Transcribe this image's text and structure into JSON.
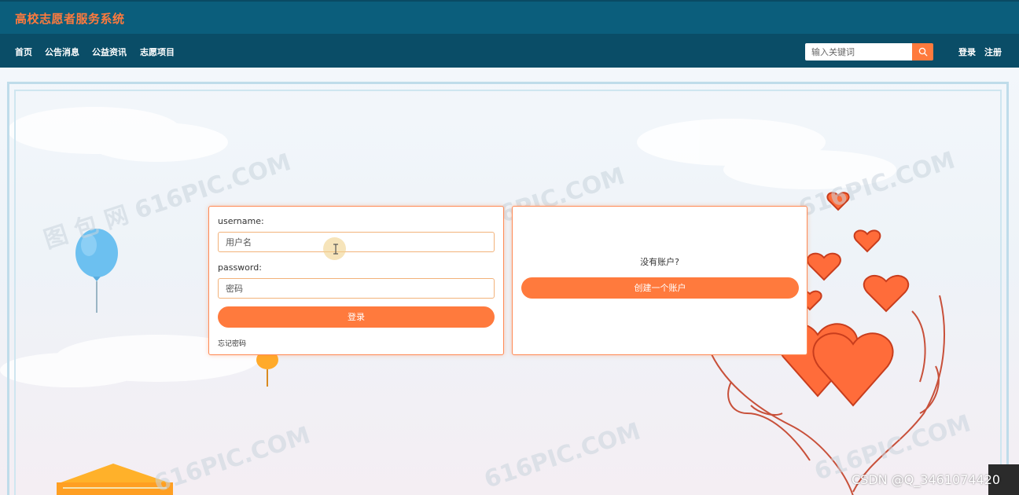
{
  "header": {
    "site_title": "高校志愿者服务系统"
  },
  "nav": {
    "items": [
      {
        "label": "首页"
      },
      {
        "label": "公告消息"
      },
      {
        "label": "公益资讯"
      },
      {
        "label": "志愿项目"
      }
    ],
    "search": {
      "placeholder": "输入关键词",
      "icon": "search-icon"
    },
    "login_label": "登录",
    "register_label": "注册"
  },
  "login_form": {
    "username_label": "username:",
    "username_placeholder": "用户名",
    "password_label": "password:",
    "password_placeholder": "密码",
    "submit_label": "登录",
    "forgot_label": "忘记密码"
  },
  "register_panel": {
    "prompt": "没有账户?",
    "create_label": "创建一个账户"
  },
  "overlay": {
    "watermark": "CSDN @Q_3461074420"
  },
  "colors": {
    "header_bg": "#0b5e7c",
    "nav_bg": "#0a4d67",
    "accent": "#ff7a3d",
    "card_border": "#ff8a55"
  }
}
